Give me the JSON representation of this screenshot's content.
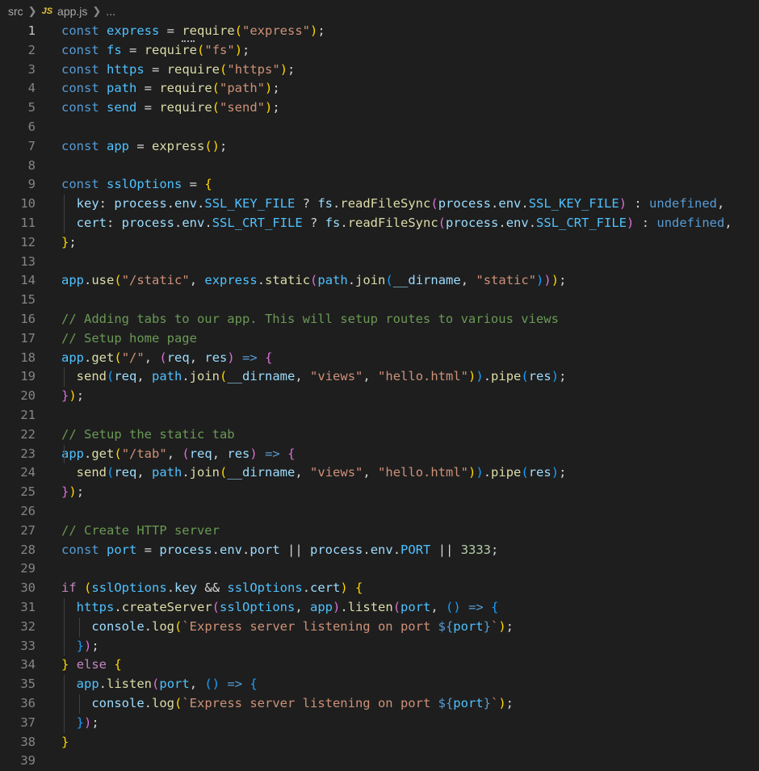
{
  "breadcrumb": {
    "folder": "src",
    "file_icon": "JS",
    "file": "app.js",
    "more": "..."
  },
  "editor": {
    "active_line": 1,
    "lines": [
      [
        [
          "kw",
          "const"
        ],
        [
          "p",
          " "
        ],
        [
          "c",
          "express"
        ],
        [
          "p",
          " = "
        ],
        [
          "f",
          "require"
        ],
        [
          "b1",
          "("
        ],
        [
          "s",
          "\"express\""
        ],
        [
          "b1",
          ")"
        ],
        [
          "p",
          ";"
        ]
      ],
      [
        [
          "kw",
          "const"
        ],
        [
          "p",
          " "
        ],
        [
          "c",
          "fs"
        ],
        [
          "p",
          " = "
        ],
        [
          "f",
          "require"
        ],
        [
          "b1",
          "("
        ],
        [
          "s",
          "\"fs\""
        ],
        [
          "b1",
          ")"
        ],
        [
          "p",
          ";"
        ]
      ],
      [
        [
          "kw",
          "const"
        ],
        [
          "p",
          " "
        ],
        [
          "c",
          "https"
        ],
        [
          "p",
          " = "
        ],
        [
          "f",
          "require"
        ],
        [
          "b1",
          "("
        ],
        [
          "s",
          "\"https\""
        ],
        [
          "b1",
          ")"
        ],
        [
          "p",
          ";"
        ]
      ],
      [
        [
          "kw",
          "const"
        ],
        [
          "p",
          " "
        ],
        [
          "c",
          "path"
        ],
        [
          "p",
          " = "
        ],
        [
          "f",
          "require"
        ],
        [
          "b1",
          "("
        ],
        [
          "s",
          "\"path\""
        ],
        [
          "b1",
          ")"
        ],
        [
          "p",
          ";"
        ]
      ],
      [
        [
          "kw",
          "const"
        ],
        [
          "p",
          " "
        ],
        [
          "c",
          "send"
        ],
        [
          "p",
          " = "
        ],
        [
          "f",
          "require"
        ],
        [
          "b1",
          "("
        ],
        [
          "s",
          "\"send\""
        ],
        [
          "b1",
          ")"
        ],
        [
          "p",
          ";"
        ]
      ],
      [],
      [
        [
          "kw",
          "const"
        ],
        [
          "p",
          " "
        ],
        [
          "c",
          "app"
        ],
        [
          "p",
          " = "
        ],
        [
          "f",
          "express"
        ],
        [
          "b1",
          "()"
        ],
        [
          "p",
          ";"
        ]
      ],
      [],
      [
        [
          "kw",
          "const"
        ],
        [
          "p",
          " "
        ],
        [
          "c",
          "sslOptions"
        ],
        [
          "p",
          " = "
        ],
        [
          "b1",
          "{"
        ]
      ],
      [
        [
          "p",
          "  "
        ],
        [
          "v",
          "key"
        ],
        [
          "p",
          ": "
        ],
        [
          "v",
          "process"
        ],
        [
          "p",
          "."
        ],
        [
          "v",
          "env"
        ],
        [
          "p",
          "."
        ],
        [
          "c",
          "SSL_KEY_FILE"
        ],
        [
          "p",
          " ? "
        ],
        [
          "v",
          "fs"
        ],
        [
          "p",
          "."
        ],
        [
          "f",
          "readFileSync"
        ],
        [
          "b2",
          "("
        ],
        [
          "v",
          "process"
        ],
        [
          "p",
          "."
        ],
        [
          "v",
          "env"
        ],
        [
          "p",
          "."
        ],
        [
          "c",
          "SSL_KEY_FILE"
        ],
        [
          "b2",
          ")"
        ],
        [
          "p",
          " : "
        ],
        [
          "kw",
          "undefined"
        ],
        [
          "p",
          ","
        ]
      ],
      [
        [
          "p",
          "  "
        ],
        [
          "v",
          "cert"
        ],
        [
          "p",
          ": "
        ],
        [
          "v",
          "process"
        ],
        [
          "p",
          "."
        ],
        [
          "v",
          "env"
        ],
        [
          "p",
          "."
        ],
        [
          "c",
          "SSL_CRT_FILE"
        ],
        [
          "p",
          " ? "
        ],
        [
          "v",
          "fs"
        ],
        [
          "p",
          "."
        ],
        [
          "f",
          "readFileSync"
        ],
        [
          "b2",
          "("
        ],
        [
          "v",
          "process"
        ],
        [
          "p",
          "."
        ],
        [
          "v",
          "env"
        ],
        [
          "p",
          "."
        ],
        [
          "c",
          "SSL_CRT_FILE"
        ],
        [
          "b2",
          ")"
        ],
        [
          "p",
          " : "
        ],
        [
          "kw",
          "undefined"
        ],
        [
          "p",
          ","
        ]
      ],
      [
        [
          "b1",
          "}"
        ],
        [
          "p",
          ";"
        ]
      ],
      [],
      [
        [
          "c",
          "app"
        ],
        [
          "p",
          "."
        ],
        [
          "f",
          "use"
        ],
        [
          "b1",
          "("
        ],
        [
          "s",
          "\"/static\""
        ],
        [
          "p",
          ", "
        ],
        [
          "c",
          "express"
        ],
        [
          "p",
          "."
        ],
        [
          "f",
          "static"
        ],
        [
          "b2",
          "("
        ],
        [
          "c",
          "path"
        ],
        [
          "p",
          "."
        ],
        [
          "f",
          "join"
        ],
        [
          "b3",
          "("
        ],
        [
          "v",
          "__dirname"
        ],
        [
          "p",
          ", "
        ],
        [
          "s",
          "\"static\""
        ],
        [
          "b3",
          ")"
        ],
        [
          "b2",
          ")"
        ],
        [
          "b1",
          ")"
        ],
        [
          "p",
          ";"
        ]
      ],
      [],
      [
        [
          "cm",
          "// Adding tabs to our app. This will setup routes to various views"
        ]
      ],
      [
        [
          "cm",
          "// Setup home page"
        ]
      ],
      [
        [
          "c",
          "app"
        ],
        [
          "p",
          "."
        ],
        [
          "f",
          "get"
        ],
        [
          "b1",
          "("
        ],
        [
          "s",
          "\"/\""
        ],
        [
          "p",
          ", "
        ],
        [
          "b2",
          "("
        ],
        [
          "v",
          "req"
        ],
        [
          "p",
          ", "
        ],
        [
          "v",
          "res"
        ],
        [
          "b2",
          ")"
        ],
        [
          "p",
          " "
        ],
        [
          "kw",
          "=>"
        ],
        [
          "p",
          " "
        ],
        [
          "b2",
          "{"
        ]
      ],
      [
        [
          "p",
          "  "
        ],
        [
          "f",
          "send"
        ],
        [
          "b3",
          "("
        ],
        [
          "v",
          "req"
        ],
        [
          "p",
          ", "
        ],
        [
          "c",
          "path"
        ],
        [
          "p",
          "."
        ],
        [
          "f",
          "join"
        ],
        [
          "b1",
          "("
        ],
        [
          "v",
          "__dirname"
        ],
        [
          "p",
          ", "
        ],
        [
          "s",
          "\"views\""
        ],
        [
          "p",
          ", "
        ],
        [
          "s",
          "\"hello.html\""
        ],
        [
          "b1",
          ")"
        ],
        [
          "b3",
          ")"
        ],
        [
          "p",
          "."
        ],
        [
          "f",
          "pipe"
        ],
        [
          "b3",
          "("
        ],
        [
          "v",
          "res"
        ],
        [
          "b3",
          ")"
        ],
        [
          "p",
          ";"
        ]
      ],
      [
        [
          "b2",
          "}"
        ],
        [
          "b1",
          ")"
        ],
        [
          "p",
          ";"
        ]
      ],
      [],
      [
        [
          "cm",
          "// Setup the static tab"
        ]
      ],
      [
        [
          "c",
          "app"
        ],
        [
          "p",
          "."
        ],
        [
          "f",
          "get"
        ],
        [
          "b1",
          "("
        ],
        [
          "s",
          "\"/tab\""
        ],
        [
          "p",
          ", "
        ],
        [
          "b2",
          "("
        ],
        [
          "v",
          "req"
        ],
        [
          "p",
          ", "
        ],
        [
          "v",
          "res"
        ],
        [
          "b2",
          ")"
        ],
        [
          "p",
          " "
        ],
        [
          "kw",
          "=>"
        ],
        [
          "p",
          " "
        ],
        [
          "b2",
          "{"
        ]
      ],
      [
        [
          "p",
          "  "
        ],
        [
          "f",
          "send"
        ],
        [
          "b3",
          "("
        ],
        [
          "v",
          "req"
        ],
        [
          "p",
          ", "
        ],
        [
          "c",
          "path"
        ],
        [
          "p",
          "."
        ],
        [
          "f",
          "join"
        ],
        [
          "b1",
          "("
        ],
        [
          "v",
          "__dirname"
        ],
        [
          "p",
          ", "
        ],
        [
          "s",
          "\"views\""
        ],
        [
          "p",
          ", "
        ],
        [
          "s",
          "\"hello.html\""
        ],
        [
          "b1",
          ")"
        ],
        [
          "b3",
          ")"
        ],
        [
          "p",
          "."
        ],
        [
          "f",
          "pipe"
        ],
        [
          "b3",
          "("
        ],
        [
          "v",
          "res"
        ],
        [
          "b3",
          ")"
        ],
        [
          "p",
          ";"
        ]
      ],
      [
        [
          "b2",
          "}"
        ],
        [
          "b1",
          ")"
        ],
        [
          "p",
          ";"
        ]
      ],
      [],
      [
        [
          "cm",
          "// Create HTTP server"
        ]
      ],
      [
        [
          "kw",
          "const"
        ],
        [
          "p",
          " "
        ],
        [
          "c",
          "port"
        ],
        [
          "p",
          " = "
        ],
        [
          "v",
          "process"
        ],
        [
          "p",
          "."
        ],
        [
          "v",
          "env"
        ],
        [
          "p",
          "."
        ],
        [
          "v",
          "port"
        ],
        [
          "p",
          " || "
        ],
        [
          "v",
          "process"
        ],
        [
          "p",
          "."
        ],
        [
          "v",
          "env"
        ],
        [
          "p",
          "."
        ],
        [
          "c",
          "PORT"
        ],
        [
          "p",
          " || "
        ],
        [
          "n",
          "3333"
        ],
        [
          "p",
          ";"
        ]
      ],
      [],
      [
        [
          "kw2",
          "if"
        ],
        [
          "p",
          " "
        ],
        [
          "b1",
          "("
        ],
        [
          "c",
          "sslOptions"
        ],
        [
          "p",
          "."
        ],
        [
          "v",
          "key"
        ],
        [
          "p",
          " && "
        ],
        [
          "c",
          "sslOptions"
        ],
        [
          "p",
          "."
        ],
        [
          "v",
          "cert"
        ],
        [
          "b1",
          ")"
        ],
        [
          "p",
          " "
        ],
        [
          "b1",
          "{"
        ]
      ],
      [
        [
          "p",
          "  "
        ],
        [
          "c",
          "https"
        ],
        [
          "p",
          "."
        ],
        [
          "f",
          "createServer"
        ],
        [
          "b2",
          "("
        ],
        [
          "c",
          "sslOptions"
        ],
        [
          "p",
          ", "
        ],
        [
          "c",
          "app"
        ],
        [
          "b2",
          ")"
        ],
        [
          "p",
          "."
        ],
        [
          "f",
          "listen"
        ],
        [
          "b2",
          "("
        ],
        [
          "c",
          "port"
        ],
        [
          "p",
          ", "
        ],
        [
          "b3",
          "()"
        ],
        [
          "p",
          " "
        ],
        [
          "kw",
          "=>"
        ],
        [
          "p",
          " "
        ],
        [
          "b3",
          "{"
        ]
      ],
      [
        [
          "p",
          "    "
        ],
        [
          "v",
          "console"
        ],
        [
          "p",
          "."
        ],
        [
          "f",
          "log"
        ],
        [
          "b1",
          "("
        ],
        [
          "s",
          "`Express server listening on port "
        ],
        [
          "kw",
          "${"
        ],
        [
          "c",
          "port"
        ],
        [
          "kw",
          "}"
        ],
        [
          "s",
          "`"
        ],
        [
          "b1",
          ")"
        ],
        [
          "p",
          ";"
        ]
      ],
      [
        [
          "p",
          "  "
        ],
        [
          "b3",
          "}"
        ],
        [
          "b2",
          ")"
        ],
        [
          "p",
          ";"
        ]
      ],
      [
        [
          "b1",
          "}"
        ],
        [
          "p",
          " "
        ],
        [
          "kw2",
          "else"
        ],
        [
          "p",
          " "
        ],
        [
          "b1",
          "{"
        ]
      ],
      [
        [
          "p",
          "  "
        ],
        [
          "c",
          "app"
        ],
        [
          "p",
          "."
        ],
        [
          "f",
          "listen"
        ],
        [
          "b2",
          "("
        ],
        [
          "c",
          "port"
        ],
        [
          "p",
          ", "
        ],
        [
          "b3",
          "()"
        ],
        [
          "p",
          " "
        ],
        [
          "kw",
          "=>"
        ],
        [
          "p",
          " "
        ],
        [
          "b3",
          "{"
        ]
      ],
      [
        [
          "p",
          "    "
        ],
        [
          "v",
          "console"
        ],
        [
          "p",
          "."
        ],
        [
          "f",
          "log"
        ],
        [
          "b1",
          "("
        ],
        [
          "s",
          "`Express server listening on port "
        ],
        [
          "kw",
          "${"
        ],
        [
          "c",
          "port"
        ],
        [
          "kw",
          "}"
        ],
        [
          "s",
          "`"
        ],
        [
          "b1",
          ")"
        ],
        [
          "p",
          ";"
        ]
      ],
      [
        [
          "p",
          "  "
        ],
        [
          "b3",
          "}"
        ],
        [
          "b2",
          ")"
        ],
        [
          "p",
          ";"
        ]
      ],
      [
        [
          "b1",
          "}"
        ]
      ],
      []
    ]
  },
  "colors": {
    "background": "#1e1e1e",
    "keyword": "#569cd6",
    "control": "#c586c0",
    "variable": "#9cdcfe",
    "constant": "#4fc1ff",
    "function": "#dcdcaa",
    "string": "#ce9178",
    "number": "#b5cea8",
    "comment": "#6a9955"
  }
}
